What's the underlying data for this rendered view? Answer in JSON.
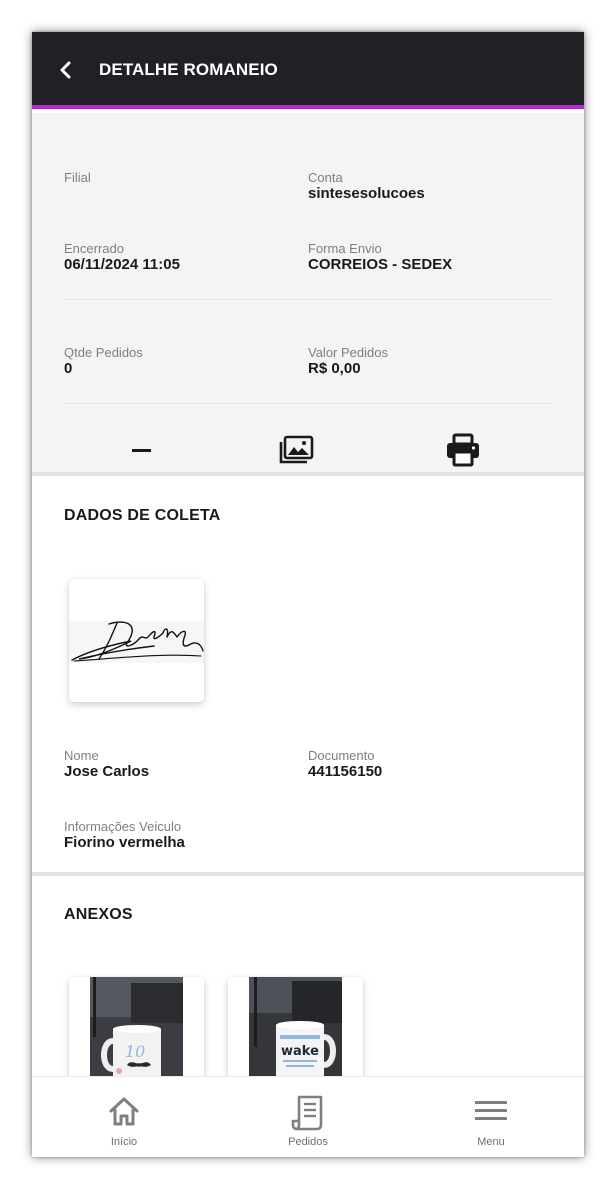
{
  "header": {
    "title": "DETALHE ROMANEIO",
    "back_icon": "chevron-left-icon"
  },
  "summary": {
    "filial": {
      "label": "Filial",
      "value": ""
    },
    "conta": {
      "label": "Conta",
      "value": "sintesesolucoes"
    },
    "encerrado": {
      "label": "Encerrado",
      "value": "06/11/2024 11:05"
    },
    "forma_envio": {
      "label": "Forma Envio",
      "value": "CORREIOS - SEDEX"
    },
    "qtde_pedidos": {
      "label": "Qtde Pedidos",
      "value": "0"
    },
    "valor_pedidos": {
      "label": "Valor Pedidos",
      "value": "R$ 0,00"
    },
    "actions": [
      "minus-icon",
      "photo-library-icon",
      "printer-icon"
    ]
  },
  "coleta": {
    "title": "DADOS DE COLETA",
    "nome": {
      "label": "Nome",
      "value": "Jose Carlos"
    },
    "documento": {
      "label": "Documento",
      "value": "441156150"
    },
    "veiculo": {
      "label": "Informações Veiculo",
      "value": "Fiorino vermelha"
    }
  },
  "anexos": {
    "title": "ANEXOS"
  },
  "nav": {
    "inicio": "Início",
    "pedidos": "Pedidos",
    "menu": "Menu"
  },
  "colors": {
    "header_bg": "#1f2125",
    "accent": "#b62ad6",
    "summary_bg": "#f4f4f4"
  }
}
